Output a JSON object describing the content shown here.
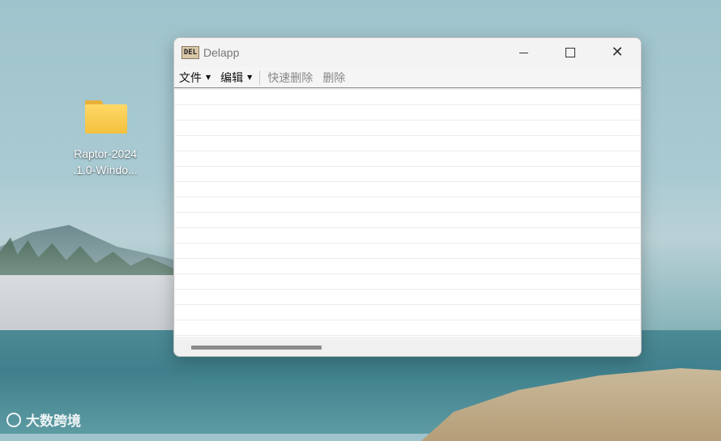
{
  "desktop": {
    "icons": [
      {
        "label_line1": "Raptor-2024",
        "label_line2": ".1.0-Windo..."
      }
    ],
    "watermark": "大数跨境"
  },
  "window": {
    "title": "Delapp",
    "app_icon_text": "DEL",
    "menu": {
      "file": "文件",
      "edit": "编辑"
    },
    "toolbar": {
      "quick_delete": "快速删除",
      "delete": "删除"
    },
    "controls": {
      "close": "✕"
    },
    "list": {
      "rows": 16
    }
  }
}
